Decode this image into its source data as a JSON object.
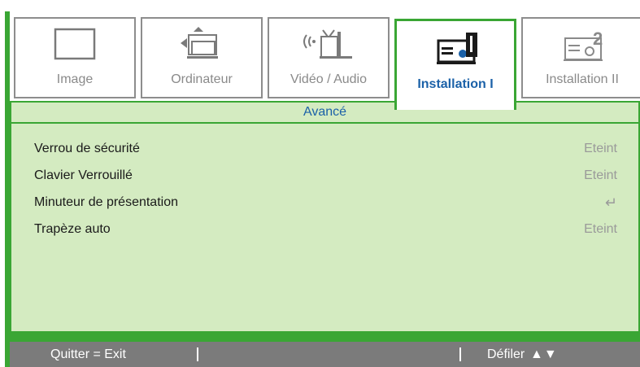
{
  "tabs": [
    {
      "label": "Image",
      "icon": "monitor-icon"
    },
    {
      "label": "Ordinateur",
      "icon": "computer-icon"
    },
    {
      "label": "Vidéo / Audio",
      "icon": "video-audio-icon"
    },
    {
      "label": "Installation I",
      "icon": "projector-1-icon",
      "active": true
    },
    {
      "label": "Installation II",
      "icon": "projector-2-icon"
    }
  ],
  "panel": {
    "title": "Avancé",
    "rows": [
      {
        "label": "Verrou de sécurité",
        "value": "Eteint"
      },
      {
        "label": "Clavier Verrouillé",
        "value": "Eteint"
      },
      {
        "label": "Minuteur de présentation",
        "value": "↵",
        "value_icon": "enter-icon"
      },
      {
        "label": "Trapèze auto",
        "value": "Eteint"
      }
    ]
  },
  "footer": {
    "quit": "Quitter = Exit",
    "scroll": "Défiler",
    "scroll_arrows": "▲▼"
  },
  "colors": {
    "accent_green": "#3aa634",
    "panel_bg": "#d4ebc1",
    "active_label_blue": "#1b61a8",
    "footer_bg": "#7b7b7b"
  }
}
